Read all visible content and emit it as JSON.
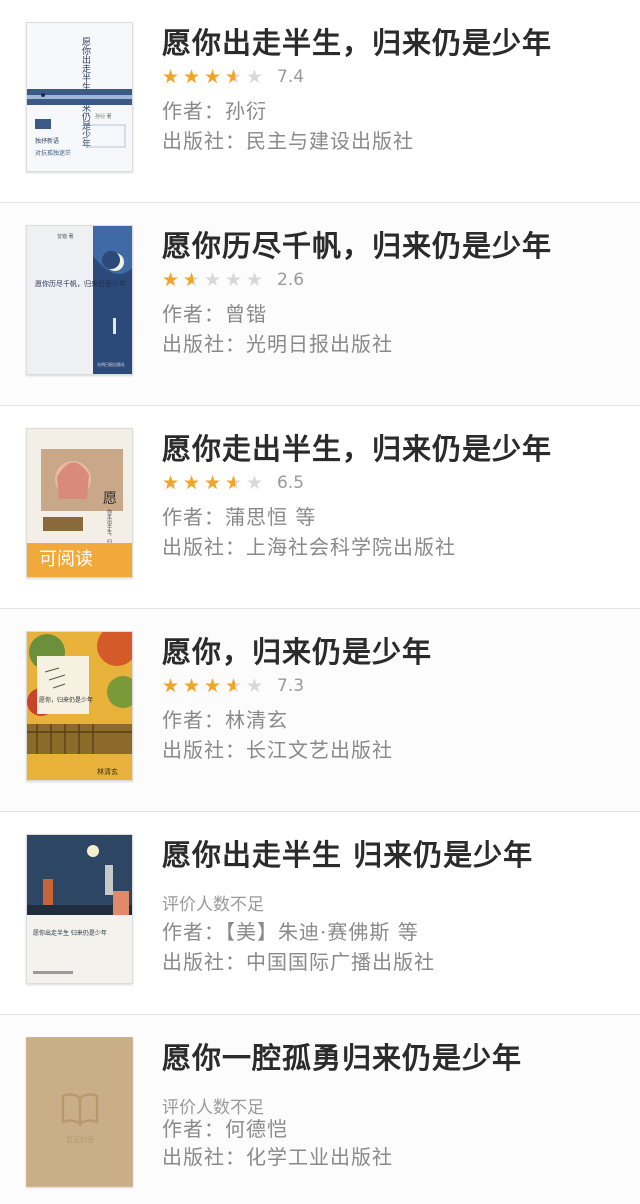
{
  "labels": {
    "author_prefix": "作者：",
    "publisher_prefix": "出版社：",
    "no_rating": "评价人数不足"
  },
  "colors": {
    "star_filled": "#f2a425",
    "star_empty": "#d8d8d8",
    "badge": "#f0a93a"
  },
  "books": [
    {
      "title": "愿你出走半生，归来仍是少年",
      "rating": 3.5,
      "score": "7.4",
      "author": "孙衍",
      "publisher": "民主与建设出版社",
      "cover": {
        "title_text": "愿你出走半生 归来仍是少年",
        "tagline": "独抒新语",
        "bottom_text": "对抗孤独迷茫",
        "author_text": "孙衍 著"
      }
    },
    {
      "title": "愿你历尽千帆，归来仍是少年",
      "rating": 1.5,
      "score": "2.6",
      "author": "曾锴",
      "publisher": "光明日报出版社",
      "cover": {
        "title_text": "愿你历尽千帆，归来仍是少年",
        "author_text": "曾锴 著",
        "side_text": "光明日报出版社"
      }
    },
    {
      "title": "愿你走出半生，归来仍是少年",
      "rating": 3.5,
      "score": "6.5",
      "author": "蒲思恒 等",
      "publisher": "上海社会科学院出版社",
      "cover": {
        "title_char": "愿",
        "side_text": "你走出半生，归来仍是少年",
        "badge": "可阅读"
      }
    },
    {
      "title": "愿你，归来仍是少年",
      "rating": 3.5,
      "score": "7.3",
      "author": "林清玄",
      "publisher": "长江文艺出版社",
      "cover": {
        "title_text": "愿你，归来仍是少年",
        "signature": "林清玄"
      }
    },
    {
      "title": "愿你出走半生 归来仍是少年",
      "rating": null,
      "score": "",
      "author": "【美】朱迪·赛佛斯 等",
      "publisher": "中国国际广播出版社",
      "cover": {
        "title_text": "愿你出走半生 归来仍是少年"
      }
    },
    {
      "title": "愿你一腔孤勇归来仍是少年",
      "rating": null,
      "score": "",
      "author": "何德恺",
      "publisher": "化学工业出版社",
      "cover": {
        "placeholder_icon": "book-open-icon",
        "placeholder_text": "暂无封面"
      }
    }
  ]
}
